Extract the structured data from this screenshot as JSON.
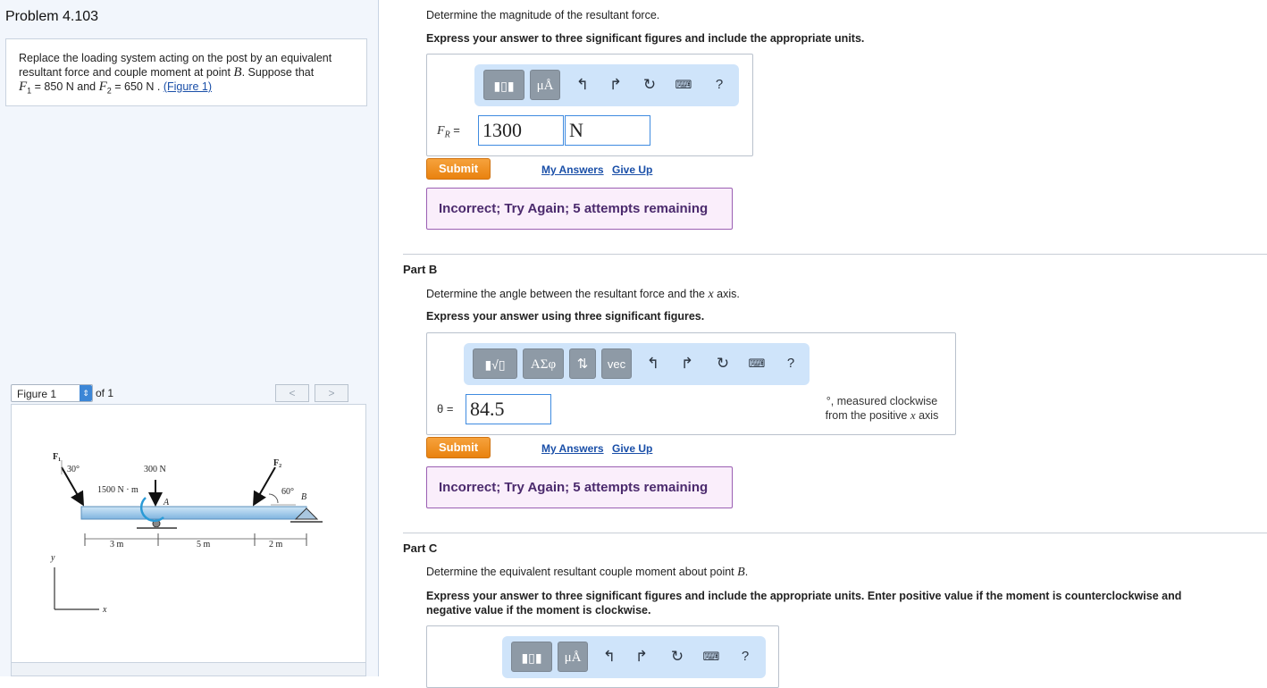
{
  "problem": {
    "title": "Problem 4.103",
    "statement_line1": "Replace the loading system acting on the post by an equivalent",
    "statement_line2_a": "resultant force and couple moment at point ",
    "point": "B",
    "statement_line2_b": ". Suppose that",
    "f1_sym": "F",
    "f1_sub": "1",
    "f1_val": " = 850  N and ",
    "f2_sym": "F",
    "f2_sub": "2",
    "f2_val": " = 650  N . ",
    "figure_link": "(Figure 1)"
  },
  "figure_nav": {
    "select_value": "Figure 1",
    "of_text": "of 1",
    "prev": "<",
    "next": ">"
  },
  "figure": {
    "f1": "F₁",
    "f1_angle": "30°",
    "f2": "F₂",
    "f2_angle": "60°",
    "force_300": "300 N",
    "moment": "1500 N · m",
    "point_a": "A",
    "point_b": "B",
    "dim_1": "3 m",
    "dim_2": "5 m",
    "dim_3": "2 m",
    "axis_y": "y",
    "axis_x": "x"
  },
  "part_a": {
    "prompt": "Determine the magnitude of the resultant force.",
    "instruction": "Express your answer to three significant figures and include the appropriate units.",
    "label": "F",
    "label_sub": "R",
    "label_eq": " =",
    "value": "1300",
    "unit": "N",
    "submit": "Submit",
    "my_answers": "My Answers",
    "give_up": "Give Up",
    "feedback": "Incorrect; Try Again; 5 attempts remaining",
    "toolbar": {
      "units_btn": "μÅ",
      "help": "?"
    }
  },
  "part_b": {
    "title": "Part B",
    "prompt_a": "Determine the angle between the resultant force and the ",
    "prompt_x": "x",
    "prompt_b": " axis.",
    "instruction": "Express your answer using three significant figures.",
    "label": "θ =",
    "value": "84.5",
    "suffix_line1": "°, measured clockwise",
    "suffix_line2_a": "from the positive ",
    "suffix_x": "x",
    "suffix_line2_b": " axis",
    "submit": "Submit",
    "my_answers": "My Answers",
    "give_up": "Give Up",
    "feedback": "Incorrect; Try Again; 5 attempts remaining",
    "toolbar": {
      "greek_btn": "ΑΣφ",
      "arrows_btn": "⇅",
      "vec_btn": "vec",
      "help": "?"
    }
  },
  "part_c": {
    "title": "Part C",
    "prompt_a": "Determine the equivalent resultant couple moment about point ",
    "prompt_b": "B",
    "prompt_c": ".",
    "instruction_line1": "Express your answer to three significant figures and include the appropriate units. Enter positive value if the moment is counterclockwise and",
    "instruction_line2": "negative value if the moment is clockwise.",
    "toolbar": {
      "units_btn": "μÅ",
      "help": "?"
    }
  }
}
